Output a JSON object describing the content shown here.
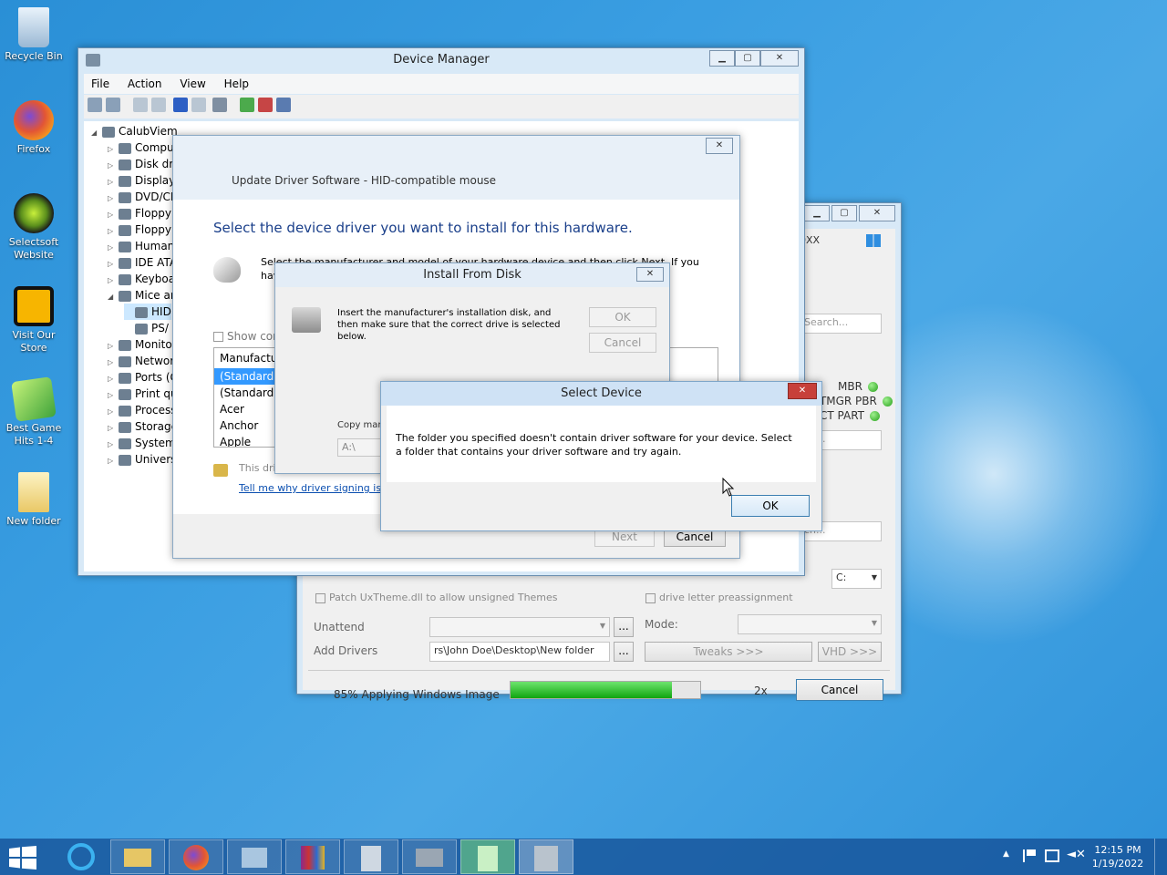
{
  "desktop": {
    "icons": [
      {
        "label": "Recycle Bin",
        "icon": "recycle-bin-icon"
      },
      {
        "label": "Firefox",
        "icon": "firefox-icon"
      },
      {
        "label": "Selectsoft Website",
        "icon": "selectsoft-icon"
      },
      {
        "label": "Visit Our Store",
        "icon": "store-icon"
      },
      {
        "label": "Best Game Hits 1-4",
        "icon": "game-icon"
      },
      {
        "label": "New folder",
        "icon": "folder-icon"
      }
    ]
  },
  "device_manager": {
    "title": "Device Manager",
    "menu": [
      "File",
      "Action",
      "View",
      "Help"
    ],
    "tree_root": "CalubViem",
    "tree": [
      "Computer",
      "Disk drives",
      "Display adapters",
      "DVD/CD-ROM drives",
      "Floppy",
      "Floppy",
      "Human",
      "IDE ATA",
      "Keyboa",
      "Mice ar",
      "HID",
      "PS/",
      "Monito",
      "Networ",
      "Ports (C",
      "Print qu",
      "Process",
      "Storage",
      "System",
      "Univers"
    ]
  },
  "back_window": {
    "title_fragment": "0XX",
    "search1": "Search...",
    "mbr": "MBR",
    "bootmgr": "OOTMGR PBR",
    "act_part": "CT PART",
    "search2": "ch...",
    "search3": "ch...",
    "drive": "C:",
    "patch_label": "Patch UxTheme.dll to allow unsigned Themes",
    "drive_letter_label": "drive letter preassignment",
    "unattend_label": "Unattend",
    "mode_label": "Mode:",
    "add_drivers_label": "Add Drivers",
    "add_drivers_value": "rs\\John Doe\\Desktop\\New folder",
    "browse": "...",
    "tweaks": "Tweaks >>>",
    "vhd": "VHD >>>",
    "status": "85% Applying Windows Image",
    "progress": 0.85,
    "speed": "2x",
    "cancel": "Cancel"
  },
  "update_driver": {
    "header": "Update Driver Software - HID-compatible mouse",
    "heading": "Select the device driver you want to install for this hardware.",
    "desc": "Select the manufacturer and model of your hardware device and then click Next. If you have a disk that contains the driver you want to install, click Have Disk.",
    "show_compatible": "Show com",
    "manufacturer_header": "Manufacture",
    "manufacturers": [
      "(Standard m",
      "(Standard sy",
      "Acer",
      "Anchor",
      "Apple"
    ],
    "signed_text": "This driver is digitally signed.",
    "signing_link": "Tell me why driver signing is important",
    "next": "Next",
    "cancel": "Cancel"
  },
  "install_disk": {
    "title": "Install From Disk",
    "text": "Insert the manufacturer's installation disk, and then make sure that the correct drive is selected below.",
    "ok": "OK",
    "cancel": "Cancel",
    "copy_label": "Copy man",
    "path": "A:\\"
  },
  "select_device": {
    "title": "Select Device",
    "message": "The folder you specified doesn't contain driver software for your device. Select a folder that contains your driver software and try again.",
    "ok": "OK",
    "close": "✕"
  },
  "taskbar": {
    "time": "12:15 PM",
    "date": "1/19/2022"
  }
}
